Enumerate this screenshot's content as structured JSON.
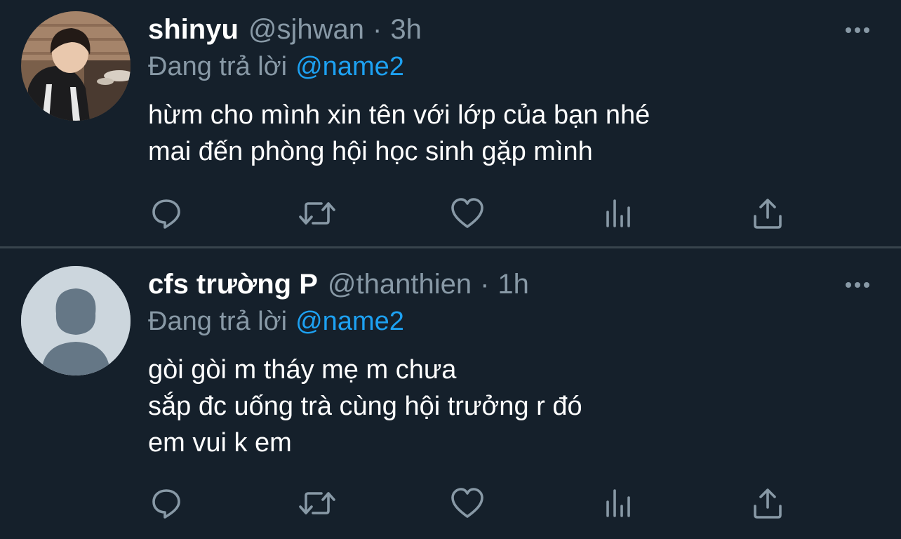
{
  "tweets": [
    {
      "display_name": "shinyu",
      "handle": "@sjhwan",
      "separator": "·",
      "time": "3h",
      "replying_label": "Đang trả lời",
      "replying_to": "@name2",
      "text_lines": [
        "hừm cho mình xin tên với lớp của bạn nhé",
        "mai đến phòng hội học sinh gặp mình"
      ],
      "avatar": "photo-avatar"
    },
    {
      "display_name": "cfs trường P",
      "handle": "@thanthien",
      "separator": "·",
      "time": "1h",
      "replying_label": "Đang trả lời",
      "replying_to": "@name2",
      "text_lines": [
        "gòi gòi m tháy mẹ m chưa",
        "sắp đc uống trà cùng hội trưởng r đó",
        "em vui k em"
      ],
      "avatar": "default-avatar"
    }
  ],
  "actions": [
    "reply-icon",
    "retweet-icon",
    "like-icon",
    "analytics-icon",
    "share-icon"
  ],
  "colors": {
    "background": "#15202b",
    "divider": "#38444d",
    "primary_text": "#ffffff",
    "secondary_text": "#8899a6",
    "mention": "#1da1f2"
  }
}
